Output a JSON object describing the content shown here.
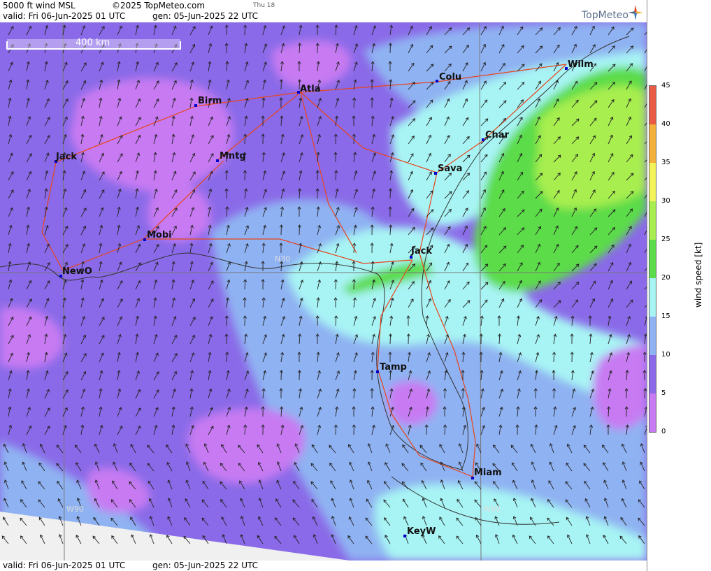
{
  "header": {
    "title": "5000 ft wind MSL",
    "copyright": "©2025 TopMeteo.com",
    "day_mark": "Thu 18",
    "valid": "valid:  Fri  06-Jun-2025  01 UTC",
    "generated": "gen: 05-Jun-2025 22 UTC"
  },
  "footer": {
    "valid": "valid:  Fri  06-Jun-2025  01 UTC",
    "generated": "gen: 05-Jun-2025 22 UTC"
  },
  "logo_text": "TopMeteo",
  "scale_bar_label": "400 km",
  "grid_labels": [
    "N30",
    "W90",
    "W80"
  ],
  "cities": [
    "Birm",
    "Atla",
    "Colu",
    "Wilm",
    "Char",
    "Jack",
    "Mntg",
    "Sava",
    "Mobi",
    "Jack",
    "NewO",
    "Tamp",
    "Miam",
    "KeyW"
  ],
  "colorbar": {
    "label": "wind speed [kt]",
    "ticks": [
      "45",
      "40",
      "35",
      "30",
      "25",
      "20",
      "15",
      "10",
      "5",
      "0"
    ],
    "colors": {
      "0-5": "#c77af2",
      "5-10": "#8a6ae8",
      "10-15": "#8fb2f2",
      "15-20": "#a8f4f4",
      "20-25": "#5cdc4a",
      "25-30": "#a8ee50",
      "30-35": "#f4f45a",
      "35-40": "#f4b03c",
      "40-45": "#ea5a44"
    }
  },
  "accent_colors": {
    "roads": "#e8451c",
    "city_marker": "#0000cc"
  }
}
